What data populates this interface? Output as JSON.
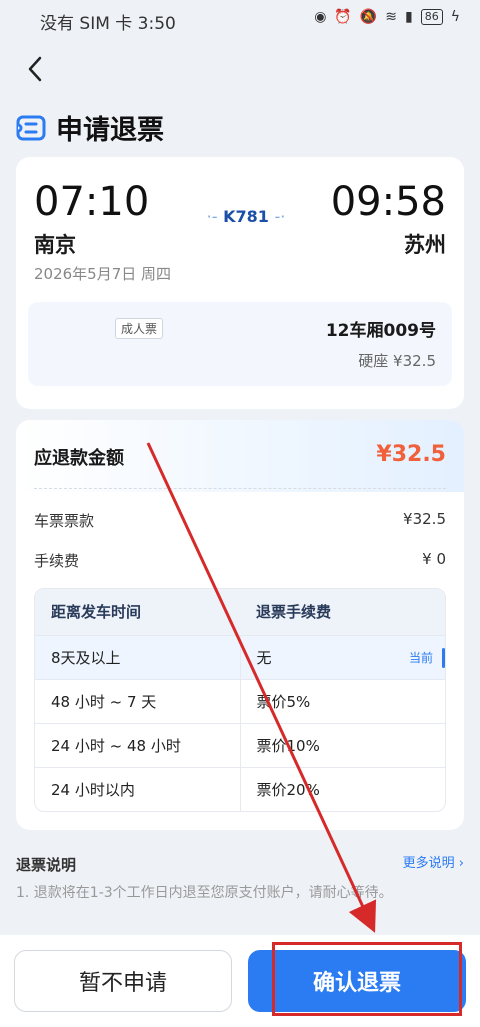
{
  "status_bar": {
    "left_text": "没有 SIM 卡 3:50",
    "battery": "86"
  },
  "header": {
    "title": "申请退票"
  },
  "trip": {
    "depart_time": "07:10",
    "arrive_time": "09:58",
    "depart_city": "南京",
    "arrive_city": "苏州",
    "train_no": "K781",
    "date": "2026年5月7日 周四",
    "ticket_type": "成人票",
    "seat": "12车厢009号",
    "seat_class_price": "硬座 ¥32.5"
  },
  "refund": {
    "label": "应退款金额",
    "amount": "¥32.5",
    "fare_label": "车票票款",
    "fare_value": "¥32.5",
    "fee_label": "手续费",
    "fee_value": "¥ 0",
    "table": {
      "headers": [
        "距离发车时间",
        "退票手续费"
      ],
      "rows": [
        {
          "time": "8天及以上",
          "fee": "无",
          "tag": "当前"
        },
        {
          "time": "48 小时 ~ 7 天",
          "fee": "票价5%"
        },
        {
          "time": "24 小时 ~ 48 小时",
          "fee": "票价10%"
        },
        {
          "time": "24 小时以内",
          "fee": "票价20%"
        }
      ]
    }
  },
  "notes": {
    "title": "退票说明",
    "more_link": "更多说明",
    "text": "1. 退款将在1-3个工作日内退至您原支付账户，请耐心等待。"
  },
  "actions": {
    "cancel_label": "暂不申请",
    "confirm_label": "确认退票"
  },
  "colors": {
    "primary": "#2b7bf2",
    "amount": "#f0603a",
    "annotation": "#d62a2a"
  }
}
